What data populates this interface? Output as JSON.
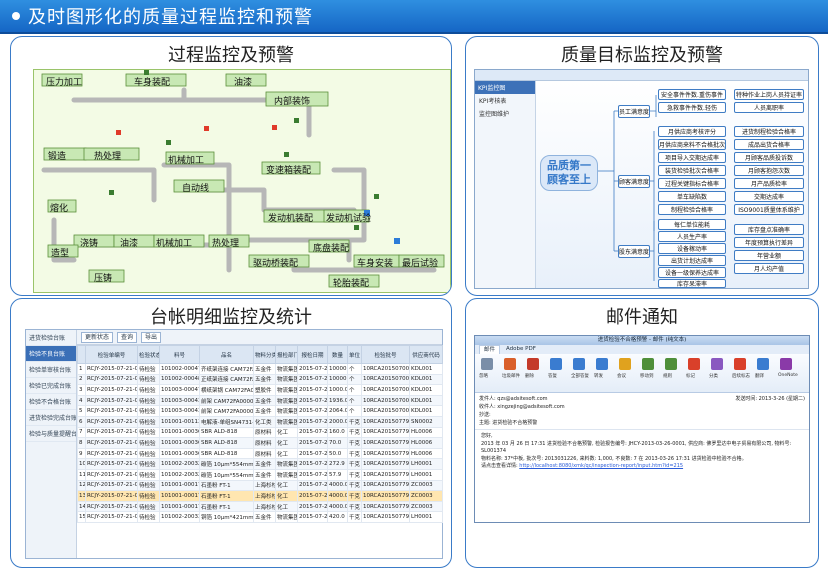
{
  "header": {
    "title": "及时图形化的质量过程监控和预警"
  },
  "panels": {
    "process": {
      "title": "过程监控及预警",
      "stations": [
        "压力加工",
        "车身装配",
        "油漆",
        "内部装饰",
        "锻造",
        "热处理",
        "机械加工",
        "变速箱装配",
        "自动线",
        "熔化",
        "发动机装配",
        "发动机试验",
        "浇铸",
        "油漆",
        "机械加工",
        "热处理",
        "底盘装配",
        "造型",
        "驱动桥装配",
        "车身安装",
        "最后试验",
        "压铸",
        "轮胎装配"
      ]
    },
    "target": {
      "title": "质量目标监控及预警",
      "sidebar_header": "KPI监控图",
      "sidebar_items": [
        "KPI考核表",
        "监控图维护"
      ],
      "root_label": "品质第一 顾客至上",
      "categories": [
        "员工满意度",
        "顾客满意度",
        "股东满意度"
      ],
      "nodes_top": [
        "安全事件件数.重伤事件",
        "特种作业上岗人员持证率",
        "急救事件件数.轻伤",
        "人员离职率"
      ],
      "nodes_mid_left": [
        "月供应商考核评分",
        "月供应商来料不合格批次",
        "项目导入交期达成率",
        "装货检验批次合格率",
        "过程关键指标合格率",
        "单车缺陷数",
        "制程检验合格率"
      ],
      "nodes_mid_right": [
        "进货制程检验合格率",
        "成品出货合格率",
        "月顾客品质投诉数",
        "月顾客抱怨次数",
        "月产品质检率",
        "交期达成率",
        "ISO9001质量体系维护"
      ],
      "nodes_bot_left": [
        "每仁单位能耗",
        "人员生产率",
        "设备稼动率",
        "出货计划达成率",
        "设备一级保养达成率",
        "库存呆滞率"
      ],
      "nodes_bot_right": [
        "库存盘点准确率",
        "年度预算执行差异",
        "年营业额",
        "月人均产值"
      ]
    },
    "ledger": {
      "title": "台帐明细监控及统计",
      "sidebar_items": [
        "进货检验台账",
        "检验不良台账",
        "检验单审核台账",
        "检验已完成台账",
        "检验不合格台账",
        "进货检验完成台账",
        "检验与质量提醒台"
      ],
      "active_item": 1,
      "toolbar": [
        "更新状态",
        "查询",
        "导出"
      ],
      "columns": [
        "",
        "检验单编号",
        "检验状态",
        "料号",
        "品名",
        "物料分类",
        "报检部门",
        "报检日期",
        "数量",
        "单位",
        "检验批号",
        "供应商代码"
      ],
      "rows": [
        [
          "1",
          "RCJY-2015-07-21-0025",
          "待检验",
          "101002-00047-5",
          "齐纸架连接 CAM72FA0000",
          "五金件",
          "物流集团",
          "2015-07-21",
          "10000.0",
          "个",
          "10RCA201507000",
          "KDL001"
        ],
        [
          "2",
          "RCJY-2015-07-21-0024",
          "待检验",
          "101002-00048-1",
          "正纸架连接 CAM72FA0000",
          "五金件",
          "物流集团",
          "2015-07-21",
          "10000.0",
          "个",
          "10RCA201507000",
          "KDL001"
        ],
        [
          "3",
          "RCJY-2015-07-21-0023",
          "待检验",
          "101003-00047-1",
          "横纸架锅 CAM72FA0000-8",
          "塑胶件",
          "物流集团",
          "2015-07-21",
          "1000.0",
          "个",
          "10RCA201507000",
          "KDL001"
        ],
        [
          "4",
          "RCJY-2015-07-21-0022",
          "待检验",
          "101003-00043-5",
          "前架 CAM72FA0000-09",
          "五金件",
          "物流集团",
          "2015-07-21",
          "1936.0",
          "个",
          "10RCA201507000",
          "KDL001"
        ],
        [
          "5",
          "RCJY-2015-07-21-0021",
          "待检验",
          "101003-00043-1",
          "前架 CAM72FA0000-09",
          "五金件",
          "物流集团",
          "2015-07-21",
          "2064.0",
          "个",
          "10RCA201507000",
          "KDL001"
        ],
        [
          "6",
          "RCJY-2015-07-21-0020",
          "待检验",
          "101001-00113-9",
          "电解液-单组SN4731-8",
          "化工类",
          "物流集团",
          "2015-07-21",
          "2000.0",
          "千克",
          "10RCA201507790",
          "SN0002"
        ],
        [
          "7",
          "RCJY-2015-07-21-0019",
          "待检验",
          "101001-00036-3",
          "SBR ALD-818",
          "原材料",
          "化工",
          "2015-07-21",
          "160.0",
          "千克",
          "10RCA201507790",
          "HL0006"
        ],
        [
          "8",
          "RCJY-2015-07-21-0018",
          "待检验",
          "101001-00036-3",
          "SBR ALD-818",
          "原材料",
          "化工",
          "2015-07-21",
          "70.0",
          "千克",
          "10RCA201507790",
          "HL0006"
        ],
        [
          "9",
          "RCJY-2015-07-21-0017",
          "待检验",
          "101001-00036-3",
          "SBR ALD-818",
          "原材料",
          "化工",
          "2015-07-21",
          "50.0",
          "千克",
          "10RCA201507790",
          "HL0006"
        ],
        [
          "10",
          "RCJY-2015-07-21-0016",
          "待检验",
          "101002-20032-0",
          "碳箔 10μm*554mm",
          "五金件",
          "物流集团",
          "2015-07-21",
          "272.9",
          "千克",
          "10RCA201507790",
          "LH0001"
        ],
        [
          "11",
          "RCJY-2015-07-21-0015",
          "待检验",
          "101002-20032-0",
          "碳箔 10μm*554mm",
          "五金件",
          "物流集团",
          "2015-07-21",
          "57.9",
          "千克",
          "10RCA201507790",
          "LH0001"
        ],
        [
          "12",
          "RCJY-2015-07-21-0014",
          "待检验",
          "101001-00017-9",
          "石墨粉 FT-1",
          "上海杉杉",
          "化工",
          "2015-07-21",
          "4000.0",
          "千克",
          "10RCA201507790",
          "ZC0003"
        ],
        [
          "13",
          "RCJY-2015-07-21-0013",
          "待检验",
          "101001-00017-9",
          "石墨粉 FT-1",
          "上海杉杉",
          "化工",
          "2015-07-21",
          "4000.0",
          "千克",
          "10RCA201507790",
          "ZC0003"
        ],
        [
          "14",
          "RCJY-2015-07-21-0012",
          "待检验",
          "101001-00017-9",
          "石墨粉 FT-1",
          "上海杉杉",
          "化工",
          "2015-07-21",
          "4000.0",
          "千克",
          "10RCA201507790",
          "ZC0003"
        ],
        [
          "15",
          "RCJY-2015-07-21-0011",
          "待检验",
          "101002-20033-0",
          "铜箔 10μm*421mm",
          "五金件",
          "物流集团",
          "2015-07-21",
          "420.0",
          "千克",
          "10RCA201507790",
          "LH0001"
        ]
      ],
      "selected_row": 12
    },
    "mail": {
      "title": "邮件通知",
      "window_title": "进货检验不合格预警 - 邮件 (纯文本)",
      "tabs": [
        "邮件",
        "Adobe PDF"
      ],
      "ribbon": [
        "忽略",
        "垃圾邮件",
        "删除",
        "答复",
        "全部答复",
        "转发",
        "会议",
        "移动到",
        "规则",
        "标记",
        "分类",
        "后续标志",
        "翻译",
        "OneNote"
      ],
      "from_label": "发件人:",
      "from": "qzs@adsitesoft.com",
      "to_label": "收件人:",
      "to": "xingzejing@adsitesoft.com",
      "cc_label": "抄送:",
      "subject_label": "主题:",
      "subject": "进货检验不合格预警",
      "date_label": "发送时间:",
      "date": "2013-3-26 (星期二)",
      "greeting": "您好,",
      "line1": "2013 年 03 月 26 日 17:31 进货检验不合格预警, 检验报告编号: JHCY-2013-03-26-0001, 供应商: 佛罗里达中电子贸易有限公司, 物料号: SL001374",
      "line2": "物料名称: 37*中板, 批次号: 2013031226, 来料数: 1,000, 不良数: 7 在 2013-03-26 17:31 进货检验中检验不合格。",
      "line3": "请点击查看详情:",
      "link": "http://localhost:8080/xmk/qc/inspection-report/input.htm?id=215"
    }
  }
}
